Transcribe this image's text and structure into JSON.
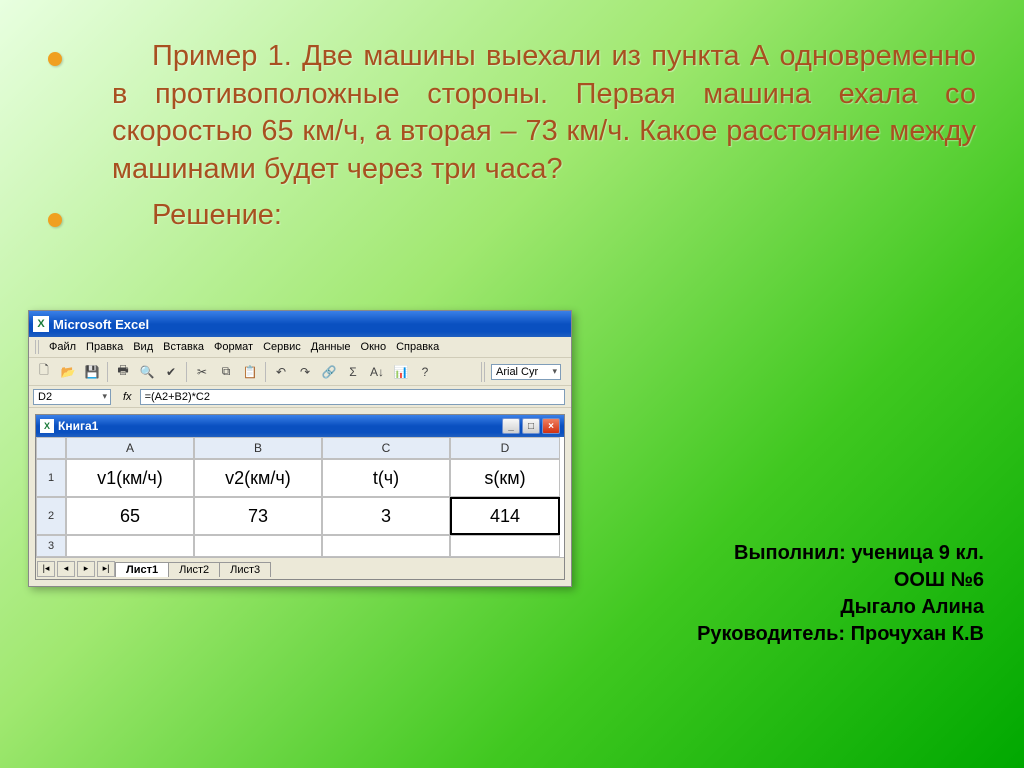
{
  "problem": {
    "text": "Пример 1. Две машины выехали из пункта А одновременно в противоположные стороны. Первая машина ехала со скоростью 65 км/ч, а вторая – 73 км/ч. Какое расстояние между машинами будет через три часа?"
  },
  "solution_label": "Решение:",
  "excel": {
    "app_title": "Microsoft Excel",
    "menus": [
      "Файл",
      "Правка",
      "Вид",
      "Вставка",
      "Формат",
      "Сервис",
      "Данные",
      "Окно",
      "Справка"
    ],
    "toolbar_icons": [
      "new-file-icon",
      "open-icon",
      "save-icon",
      "print-icon",
      "print-preview-icon",
      "spelling-icon",
      "cut-icon",
      "copy-icon",
      "paste-icon",
      "undo-icon",
      "redo-icon",
      "hyperlink-icon",
      "autosum-icon",
      "sort-asc-icon",
      "chart-wizard-icon",
      "help-icon"
    ],
    "font_name": "Arial Cyr",
    "namebox": "D2",
    "fx_label": "fx",
    "formula": "=(A2+B2)*C2",
    "book_title": "Книга1",
    "win_buttons": {
      "min": "_",
      "max": "□",
      "close": "×"
    },
    "columns": [
      "A",
      "B",
      "C",
      "D"
    ],
    "rows": [
      "1",
      "2",
      "3"
    ],
    "cells": {
      "A1": "v1(км/ч)",
      "B1": "v2(км/ч)",
      "C1": "t(ч)",
      "D1": "s(км)",
      "A2": "65",
      "B2": "73",
      "C2": "3",
      "D2": "414",
      "A3": "",
      "B3": "",
      "C3": "",
      "D3": ""
    },
    "sheet_tabs": [
      "Лист1",
      "Лист2",
      "Лист3"
    ],
    "nav": {
      "first": "|◂",
      "prev": "◂",
      "next": "▸",
      "last": "▸|"
    }
  },
  "credits": {
    "l1": "Выполнил: ученица 9 кл.",
    "l2": "ООШ №6",
    "l3": "Дыгало Алина",
    "l4": "Руководитель: Прочухан К.В"
  },
  "chart_data": {
    "type": "table",
    "title": "Книга1",
    "columns": [
      "v1(км/ч)",
      "v2(км/ч)",
      "t(ч)",
      "s(км)"
    ],
    "rows": [
      [
        65,
        73,
        3,
        414
      ]
    ],
    "formula_D2": "=(A2+B2)*C2"
  }
}
